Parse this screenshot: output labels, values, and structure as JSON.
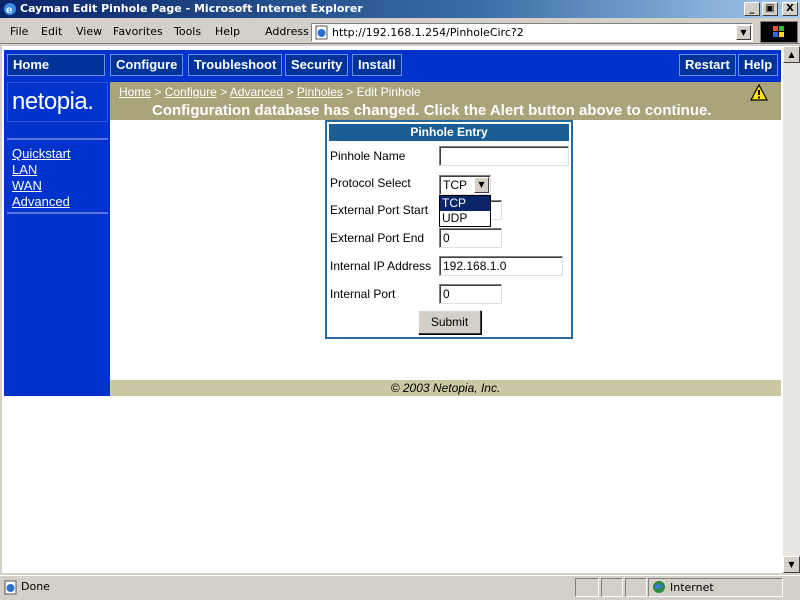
{
  "window": {
    "title": "Cayman Edit Pinhole Page - Microsoft Internet Explorer",
    "minimize_glyph": "_",
    "maximize_glyph": "▣",
    "close_glyph": "X"
  },
  "menu": {
    "items": [
      "File",
      "Edit",
      "View",
      "Favorites",
      "Tools",
      "Help"
    ],
    "address_label": "Address",
    "address_url": "http://192.168.1.254/PinholeCirc?2"
  },
  "nav": {
    "left": [
      "Home"
    ],
    "center": [
      "Configure",
      "Troubleshoot",
      "Security",
      "Install"
    ],
    "right": [
      "Restart",
      "Help"
    ]
  },
  "logo": {
    "text": "netopia."
  },
  "sidebar": {
    "links": [
      "Quickstart",
      "LAN",
      "WAN",
      "Advanced"
    ]
  },
  "breadcrumb": {
    "links": [
      "Home",
      "Configure",
      "Advanced",
      "Pinholes"
    ],
    "separator": ">",
    "current": "Edit Pinhole"
  },
  "alert": {
    "message": "Configuration database has changed. Click the Alert button above to continue."
  },
  "form": {
    "title": "Pinhole Entry",
    "fields": {
      "pinhole_name": {
        "label": "Pinhole Name",
        "value": ""
      },
      "protocol": {
        "label": "Protocol Select",
        "value": "TCP",
        "options": [
          "TCP",
          "UDP"
        ]
      },
      "ext_port_start": {
        "label": "External Port Start",
        "value": ""
      },
      "ext_port_end": {
        "label": "External Port End",
        "value": "0"
      },
      "internal_ip": {
        "label": "Internal IP Address",
        "value": "192.168.1.0"
      },
      "internal_port": {
        "label": "Internal Port",
        "value": "0"
      }
    },
    "submit_label": "Submit"
  },
  "footer": {
    "copyright": "© 2003 Netopia, Inc."
  },
  "status": {
    "text": "Done",
    "zone": "Internet"
  },
  "colors": {
    "nav_blue": "#0033cc",
    "crumb_bar": "#a9a47a",
    "form_header": "#1b5e93"
  }
}
